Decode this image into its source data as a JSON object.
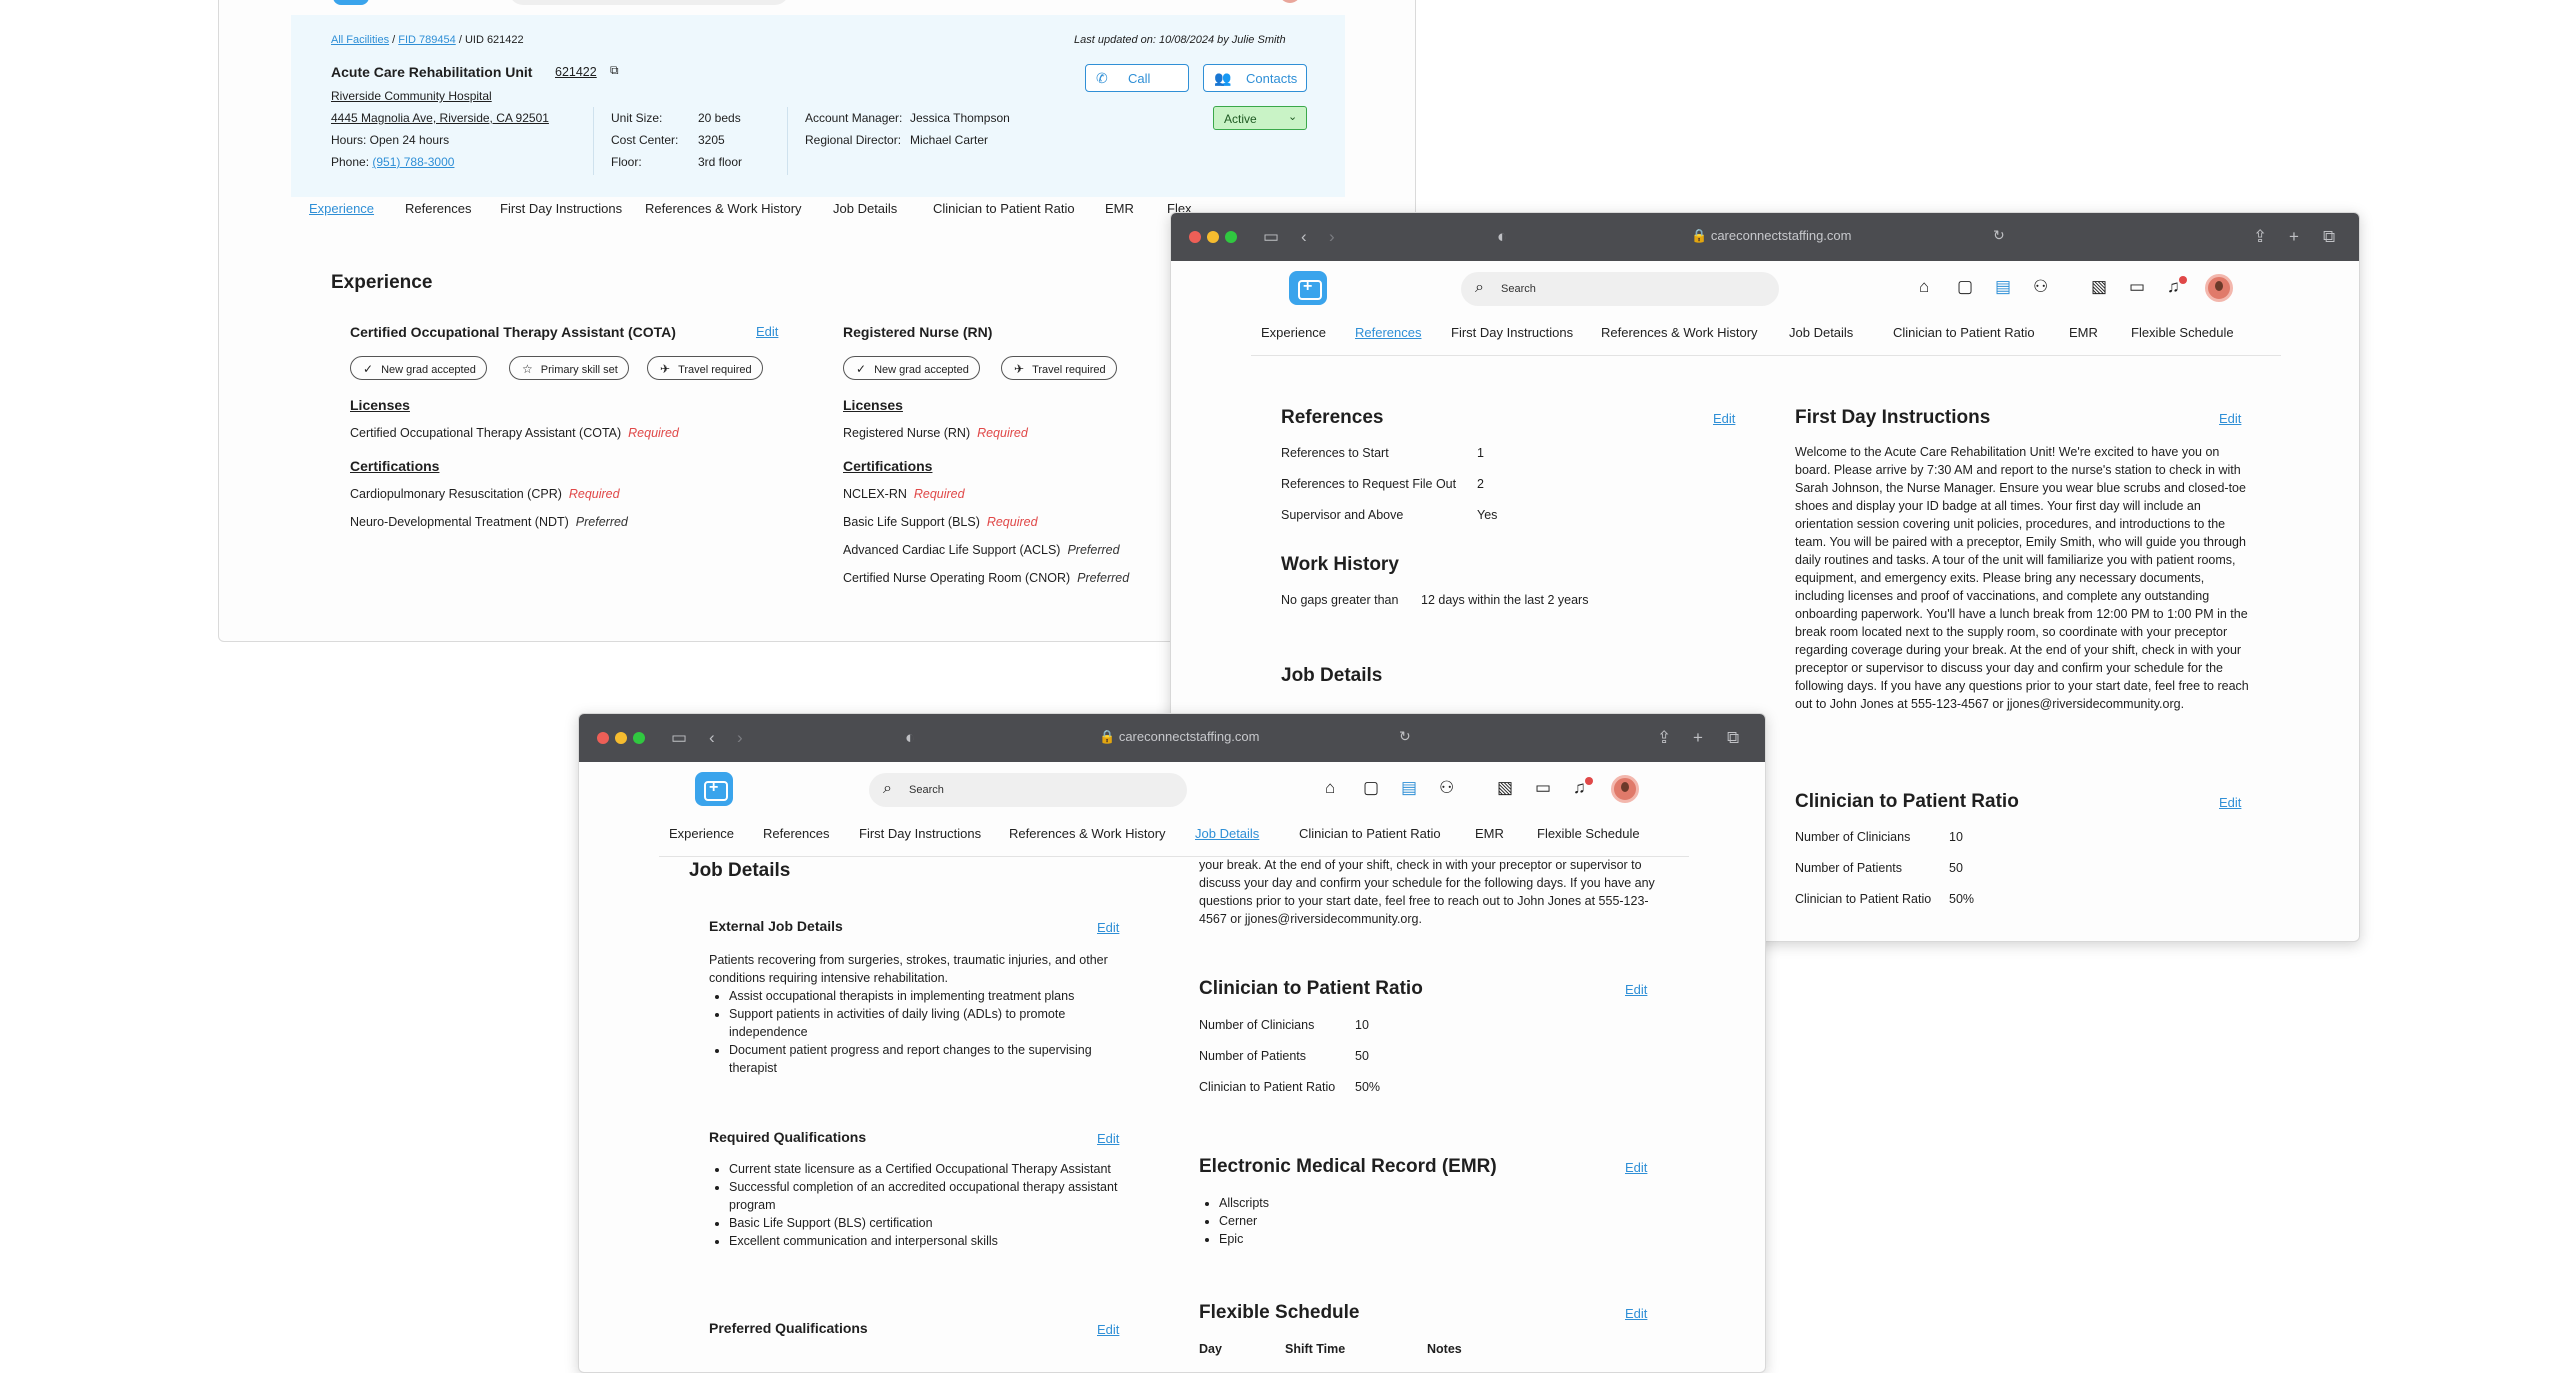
{
  "browser": {
    "url": "careconnectstaffing.com"
  },
  "header": {
    "search_placeholder": "Search",
    "breadcrumb_all": "All Facilities",
    "breadcrumb_fid": "FID 789454",
    "breadcrumb_sep1": "/",
    "breadcrumb_sep2": "/",
    "breadcrumb_uid": "UID 621422",
    "last_updated": "Last updated on: 10/08/2024 by Julie Smith"
  },
  "unit": {
    "name": "Acute Care Rehabilitation Unit",
    "id_link": "621422",
    "hospital": "Riverside Community Hospital",
    "address": "4445 Magnolia Ave, Riverside, CA 92501",
    "hours": "Hours: Open 24 hours",
    "phone_label": "Phone:",
    "phone": "(951) 788-3000",
    "unit_size_label": "Unit Size:",
    "unit_size": "20 beds",
    "cost_center_label": "Cost Center:",
    "cost_center": "3205",
    "floor_label": "Floor:",
    "floor": "3rd floor",
    "account_manager_label": "Account Manager:",
    "account_manager": "Jessica Thompson",
    "regional_director_label": "Regional Director:",
    "regional_director": "Michael Carter",
    "call_label": "Call",
    "contacts_label": "Contacts",
    "status": "Active"
  },
  "tabs": [
    "Experience",
    "References",
    "First Day Instructions",
    "References & Work History",
    "Job Details",
    "Clinician to Patient Ratio",
    "EMR",
    "Flexible Schedule"
  ],
  "tabs_truncated_last": "Flex",
  "experience": {
    "title": "Experience",
    "edit": "Edit",
    "cota": {
      "title": "Certified Occupational Therapy Assistant (COTA)",
      "chips": [
        "New grad accepted",
        "Primary skill set",
        "Travel required"
      ],
      "licenses_title": "Licenses",
      "license": "Certified Occupational Therapy Assistant (COTA)",
      "license_status": "Required",
      "certs_title": "Certifications",
      "certs": [
        {
          "name": "Cardiopulmonary Resuscitation (CPR)",
          "status": "Required"
        },
        {
          "name": "Neuro-Developmental Treatment (NDT)",
          "status": "Preferred"
        }
      ]
    },
    "rn": {
      "title": "Registered Nurse (RN)",
      "chips": [
        "New grad accepted",
        "Travel required"
      ],
      "licenses_title": "Licenses",
      "license": "Registered Nurse (RN)",
      "license_status": "Required",
      "certs_title": "Certifications",
      "certs": [
        {
          "name": "NCLEX-RN",
          "status": "Required"
        },
        {
          "name": "Basic Life Support (BLS)",
          "status": "Required"
        },
        {
          "name": "Advanced Cardiac Life Support (ACLS)",
          "status": "Preferred"
        },
        {
          "name": "Certified Nurse Operating Room (CNOR)",
          "status": "Preferred"
        }
      ]
    }
  },
  "references": {
    "title": "References",
    "edit": "Edit",
    "rows": [
      {
        "label": "References to Start",
        "value": "1"
      },
      {
        "label": "References to Request File Out",
        "value": "2"
      },
      {
        "label": "Supervisor and Above",
        "value": "Yes"
      }
    ]
  },
  "work_history": {
    "title": "Work History",
    "label": "No gaps greater than",
    "value": "12 days within the last 2 years"
  },
  "job_details_title": "Job Details",
  "first_day": {
    "title": "First Day Instructions",
    "edit": "Edit",
    "text": "Welcome to the Acute Care Rehabilitation Unit! We're excited to have you on board. Please arrive by 7:30 AM and report to the nurse's station to check in with Sarah Johnson, the Nurse Manager. Ensure you wear blue scrubs and closed-toe shoes and display your ID badge at all times. Your first day will include an orientation session covering unit policies, procedures, and introductions to the team. You will be paired with a preceptor, Emily Smith, who will guide you through daily routines and tasks. A tour of the unit will familiarize you with patient rooms, equipment, and emergency exits. Please bring any necessary documents, including licenses and proof of vaccinations, and complete any outstanding onboarding paperwork. You'll have a lunch break from 12:00 PM to 1:00 PM in the break room located next to the supply room, so coordinate with your preceptor regarding coverage during your break. At the end of your shift, check in with your preceptor or supervisor to discuss your day and confirm your schedule for the following days. If you have any questions prior to your start date, feel free to reach out to John Jones at 555-123-4567 or jjones@riversidecommunity.org.",
    "tail": "your break. At the end of your shift, check in with your preceptor or supervisor to discuss your day and confirm your schedule for the following days. If you have any questions prior to your start date, feel free to reach out to John Jones at 555-123-4567 or jjones@riversidecommunity.org."
  },
  "ratio": {
    "title": "Clinician to Patient Ratio",
    "edit": "Edit",
    "rows": [
      {
        "label": "Number of Clinicians",
        "value": "10"
      },
      {
        "label": "Number of Patients",
        "value": "50"
      },
      {
        "label": "Clinician to Patient Ratio",
        "value": "50%"
      }
    ]
  },
  "job": {
    "title": "Job Details",
    "external_title": "External Job Details",
    "edit": "Edit",
    "external_text": "Patients recovering from surgeries, strokes, traumatic injuries, and other conditions requiring intensive rehabilitation.",
    "external_bullets": [
      "Assist occupational therapists in implementing treatment plans",
      "Support patients in activities of daily living (ADLs) to promote independence",
      "Document patient progress and report changes to the supervising therapist"
    ],
    "required_title": "Required Qualifications",
    "required_bullets": [
      "Current state licensure as a Certified Occupational Therapy Assistant",
      "Successful completion of an accredited occupational therapy assistant program",
      "Basic Life Support (BLS) certification",
      "Excellent communication and interpersonal skills"
    ],
    "preferred_title": "Preferred Qualifications"
  },
  "emr": {
    "title": "Electronic Medical Record (EMR)",
    "edit": "Edit",
    "items": [
      "Allscripts",
      "Cerner",
      "Epic"
    ]
  },
  "schedule": {
    "title": "Flexible Schedule",
    "edit": "Edit",
    "col_day": "Day",
    "col_shift": "Shift Time",
    "col_notes": "Notes"
  },
  "colors": {
    "accent": "#2f8fd6",
    "required": "#e04848",
    "active_bg": "#c9f3c6",
    "chrome": "#4b4c50"
  },
  "icons": {
    "logo": "hospital-logo-icon",
    "search": "search-icon",
    "home": "home-icon",
    "briefcase": "briefcase-icon",
    "document": "document-icon",
    "users": "users-icon",
    "bell": "bell-icon"
  }
}
